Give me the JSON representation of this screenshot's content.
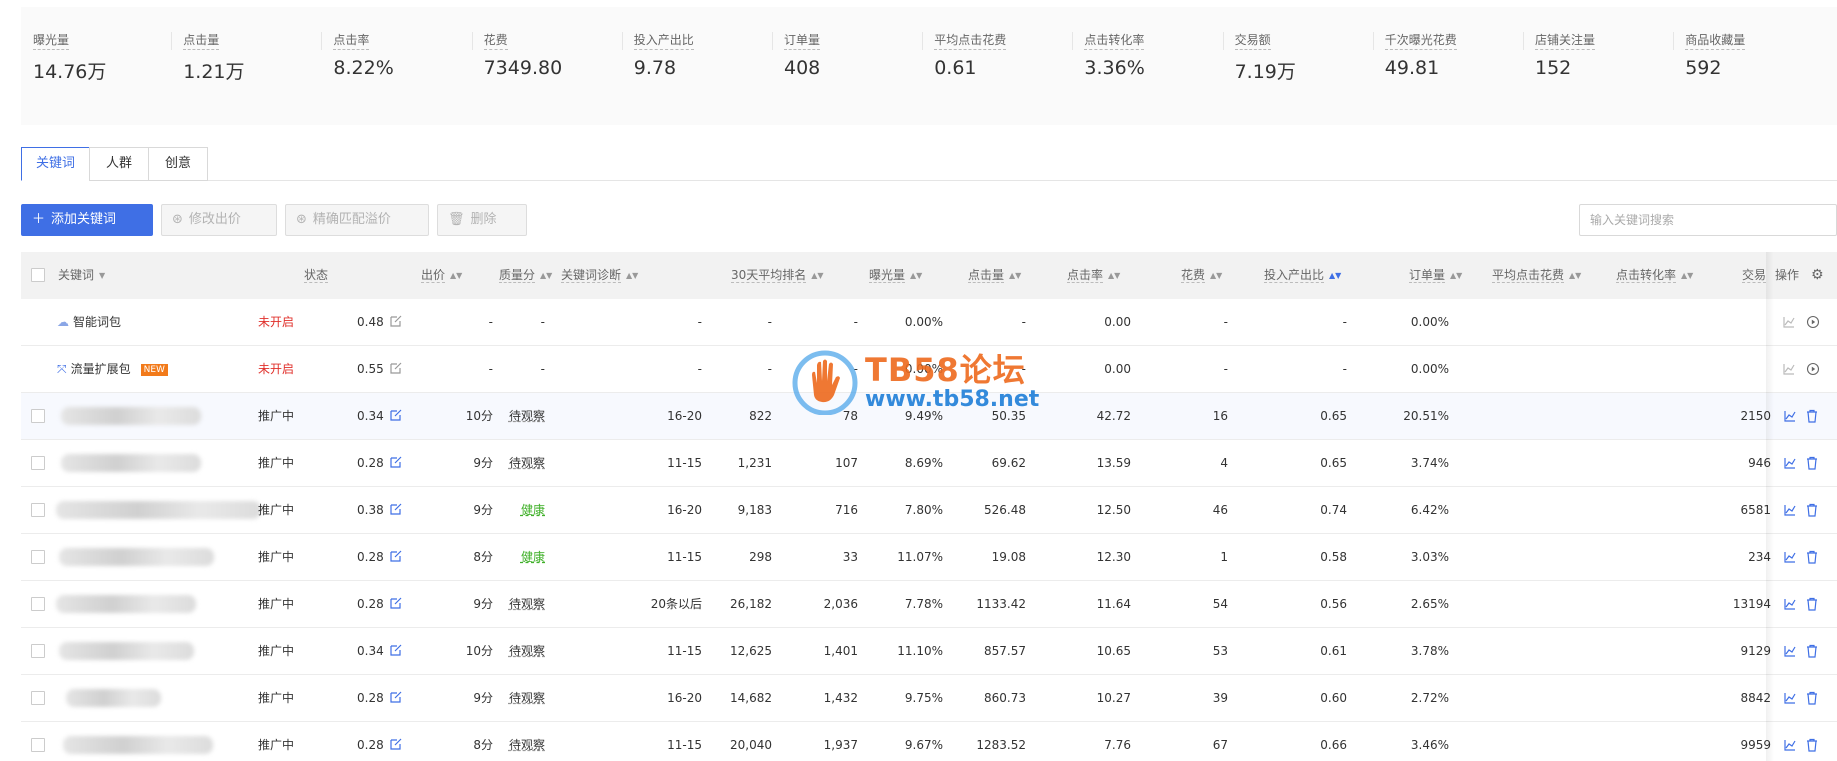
{
  "metrics": [
    {
      "label": "曝光量",
      "value": "14.76万"
    },
    {
      "label": "点击量",
      "value": "1.21万"
    },
    {
      "label": "点击率",
      "value": "8.22%"
    },
    {
      "label": "花费",
      "value": "7349.80"
    },
    {
      "label": "投入产出比",
      "value": "9.78"
    },
    {
      "label": "订单量",
      "value": "408"
    },
    {
      "label": "平均点击花费",
      "value": "0.61"
    },
    {
      "label": "点击转化率",
      "value": "3.36%"
    },
    {
      "label": "交易额",
      "value": "7.19万"
    },
    {
      "label": "千次曝光花费",
      "value": "49.81"
    },
    {
      "label": "店铺关注量",
      "value": "152"
    },
    {
      "label": "商品收藏量",
      "value": "592"
    }
  ],
  "tabs": [
    {
      "label": "关键词",
      "active": true
    },
    {
      "label": "人群",
      "active": false
    },
    {
      "label": "创意",
      "active": false
    }
  ],
  "toolbar": {
    "add_label": "添加关键词",
    "modify_bid_label": "修改出价",
    "exact_match_label": "精确匹配溢价",
    "delete_label": "删除",
    "search_placeholder": "输入关键词搜索"
  },
  "table": {
    "headers": {
      "keyword": "关键词",
      "status": "状态",
      "bid": "出价",
      "quality": "质量分",
      "diagnosis": "关键词诊断",
      "rank30": "30天平均排名",
      "impressions": "曝光量",
      "clicks": "点击量",
      "ctr": "点击率",
      "cost": "花费",
      "roi": "投入产出比",
      "orders": "订单量",
      "cpc": "平均点击花费",
      "cvr": "点击转化率",
      "gmv": "交易",
      "ops": "操作"
    },
    "special_rows": [
      {
        "name": "智能词包",
        "status": "未开启",
        "bid": "0.48",
        "quality": "-",
        "diagnosis": "-",
        "rank": "-",
        "impressions": "-",
        "clicks": "-",
        "ctr": "0.00%",
        "cost": "-",
        "roi": "0.00",
        "orders": "-",
        "cpc": "-",
        "cvr": "0.00%"
      },
      {
        "name": "流量扩展包",
        "badge": "NEW",
        "status": "未开启",
        "bid": "0.55",
        "quality": "-",
        "diagnosis": "-",
        "rank": "-",
        "impressions": "-",
        "clicks": "-",
        "ctr": "0.00%",
        "cost": "-",
        "roi": "0.00",
        "orders": "-",
        "cpc": "-",
        "cvr": "0.00%"
      }
    ],
    "rows": [
      {
        "status": "推广中",
        "bid": "0.34",
        "quality": "10分",
        "diagnosis": "待观察",
        "diag_ok": false,
        "rank": "16-20",
        "impressions": "822",
        "clicks": "78",
        "ctr": "9.49%",
        "cost": "50.35",
        "roi": "42.72",
        "orders": "16",
        "cpc": "0.65",
        "cvr": "20.51%",
        "gmv": "2150"
      },
      {
        "status": "推广中",
        "bid": "0.28",
        "quality": "9分",
        "diagnosis": "待观察",
        "diag_ok": false,
        "rank": "11-15",
        "impressions": "1,231",
        "clicks": "107",
        "ctr": "8.69%",
        "cost": "69.62",
        "roi": "13.59",
        "orders": "4",
        "cpc": "0.65",
        "cvr": "3.74%",
        "gmv": "946"
      },
      {
        "status": "推广中",
        "bid": "0.38",
        "quality": "9分",
        "diagnosis": "健康",
        "diag_ok": true,
        "rank": "16-20",
        "impressions": "9,183",
        "clicks": "716",
        "ctr": "7.80%",
        "cost": "526.48",
        "roi": "12.50",
        "orders": "46",
        "cpc": "0.74",
        "cvr": "6.42%",
        "gmv": "6581"
      },
      {
        "status": "推广中",
        "bid": "0.28",
        "quality": "8分",
        "diagnosis": "健康",
        "diag_ok": true,
        "rank": "11-15",
        "impressions": "298",
        "clicks": "33",
        "ctr": "11.07%",
        "cost": "19.08",
        "roi": "12.30",
        "orders": "1",
        "cpc": "0.58",
        "cvr": "3.03%",
        "gmv": "234"
      },
      {
        "status": "推广中",
        "bid": "0.28",
        "quality": "9分",
        "diagnosis": "待观察",
        "diag_ok": false,
        "rank": "20条以后",
        "impressions": "26,182",
        "clicks": "2,036",
        "ctr": "7.78%",
        "cost": "1133.42",
        "roi": "11.64",
        "orders": "54",
        "cpc": "0.56",
        "cvr": "2.65%",
        "gmv": "13194"
      },
      {
        "status": "推广中",
        "bid": "0.34",
        "quality": "10分",
        "diagnosis": "待观察",
        "diag_ok": false,
        "rank": "11-15",
        "impressions": "12,625",
        "clicks": "1,401",
        "ctr": "11.10%",
        "cost": "857.57",
        "roi": "10.65",
        "orders": "53",
        "cpc": "0.61",
        "cvr": "3.78%",
        "gmv": "9129"
      },
      {
        "status": "推广中",
        "bid": "0.28",
        "quality": "9分",
        "diagnosis": "待观察",
        "diag_ok": false,
        "rank": "16-20",
        "impressions": "14,682",
        "clicks": "1,432",
        "ctr": "9.75%",
        "cost": "860.73",
        "roi": "10.27",
        "orders": "39",
        "cpc": "0.60",
        "cvr": "2.72%",
        "gmv": "8842"
      },
      {
        "status": "推广中",
        "bid": "0.28",
        "quality": "8分",
        "diagnosis": "待观察",
        "diag_ok": false,
        "rank": "11-15",
        "impressions": "20,040",
        "clicks": "1,937",
        "ctr": "9.67%",
        "cost": "1283.52",
        "roi": "7.76",
        "orders": "67",
        "cpc": "0.66",
        "cvr": "3.46%",
        "gmv": "9959"
      }
    ]
  },
  "watermark": {
    "line1": "TB58论坛",
    "line2": "www.tb58.net"
  },
  "colors": {
    "accent": "#3f6fe5",
    "status_off": "#e0302b",
    "healthy": "#3fb028",
    "badge": "#f27a1a"
  }
}
